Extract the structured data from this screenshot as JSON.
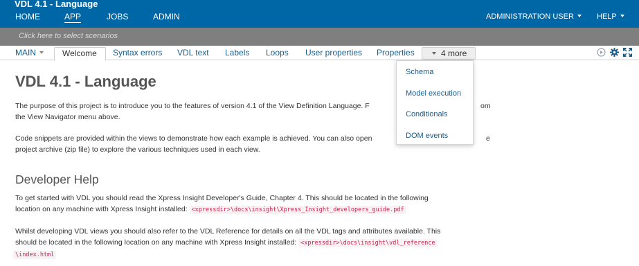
{
  "header": {
    "title": "VDL 4.1 - Language",
    "nav": [
      "HOME",
      "APP",
      "JOBS",
      "ADMIN"
    ],
    "active_nav": "APP",
    "user_menu": "ADMINISTRATION USER",
    "help_menu": "HELP"
  },
  "scenario_bar": {
    "text": "Click here to select scenarios"
  },
  "tabs": {
    "main": "MAIN",
    "items": [
      "Welcome",
      "Syntax errors",
      "VDL text",
      "Labels",
      "Loops",
      "User properties",
      "Properties"
    ],
    "active": "Welcome",
    "more": "4 more"
  },
  "toolbar_icons": [
    "play-circle-icon",
    "gear-icon",
    "fullscreen-icon"
  ],
  "dropdown": {
    "items": [
      "Schema",
      "Model execution",
      "Conditionals",
      "DOM events"
    ]
  },
  "content": {
    "title": "VDL 4.1 - Language",
    "intro_line1": "The purpose of this project is to introduce you to the features of version 4.1 of the View Definition Language. F",
    "intro_line1_end": "om",
    "intro_line2": "the View Navigator menu above.",
    "snippets_line1": "Code snippets are provided within the views to demonstrate how each example is achieved. You can also open",
    "snippets_line1_end": "e",
    "snippets_line2": "project archive (zip file) to explore the various techniques used in each view.",
    "dev_heading": "Developer Help",
    "dev_p1_line1": "To get started with VDL you should read the Xpress Insight Developer's Guide, Chapter 4. This should be located in the following",
    "dev_p1_line2": "location on any machine with Xpress Insight installed:",
    "dev_p1_path": "<xpressdir>\\docs\\insight\\Xpress_Insight_developers_guide.pdf",
    "dev_p2_line1": "Whilst developing VDL views you should also refer to the VDL Reference for details on all the VDL tags and attributes available. This",
    "dev_p2_line2": "should be located in the following location on any machine with Xpress Insight installed:",
    "dev_p2_path_part1": "<xpressdir>\\docs\\insight\\vdl_reference",
    "dev_p2_path_part2": "\\index.html"
  }
}
